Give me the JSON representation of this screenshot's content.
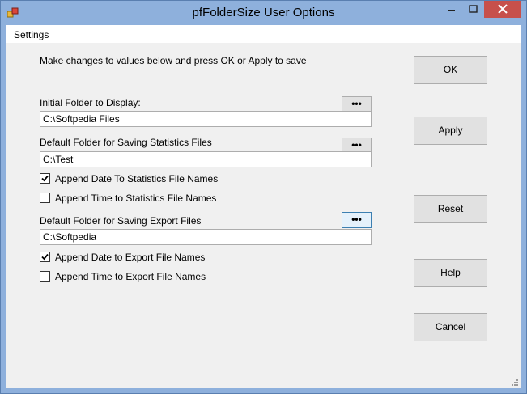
{
  "window": {
    "title": "pfFolderSize User Options",
    "minimize_glyph": "—",
    "maximize_glyph": "□",
    "close_glyph": "✕"
  },
  "menu": {
    "settings": "Settings"
  },
  "instructions": "Make changes to values below and press OK or Apply to save",
  "initial_folder": {
    "label": "Initial Folder to Display:",
    "value": "C:\\Softpedia Files",
    "browse": "•••"
  },
  "stats_folder": {
    "label": "Default Folder for Saving Statistics Files",
    "value": "C:\\Test",
    "browse": "•••"
  },
  "stats_date": {
    "label": "Append Date To Statistics File Names",
    "checked": true
  },
  "stats_time": {
    "label": "Append Time to Statistics File Names",
    "checked": false
  },
  "export_folder": {
    "label": "Default Folder for Saving Export Files",
    "value": "C:\\Softpedia",
    "browse": "•••"
  },
  "export_date": {
    "label": "Append Date to Export File Names",
    "checked": true
  },
  "export_time": {
    "label": "Append Time to Export File Names",
    "checked": false
  },
  "buttons": {
    "ok": "OK",
    "apply": "Apply",
    "reset": "Reset",
    "help": "Help",
    "cancel": "Cancel"
  },
  "icons": {
    "app": "app-icon",
    "check": "checkmark-icon",
    "grip": "size-grip-icon"
  },
  "colors": {
    "titlebar": "#8eb0dc",
    "close": "#c7504b",
    "client": "#f0f0f0"
  }
}
